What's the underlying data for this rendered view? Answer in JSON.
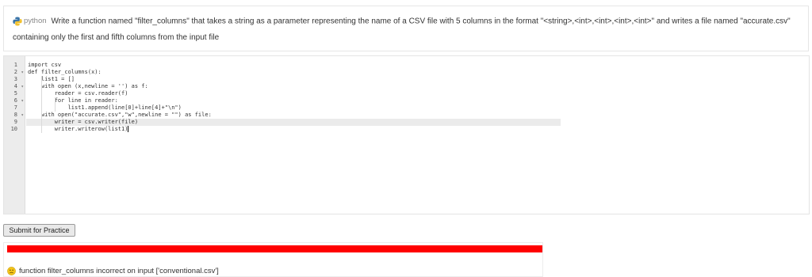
{
  "question": {
    "language": "python",
    "text": "Write a function named \"filter_columns\" that takes a string as a parameter representing the name of a CSV file with 5 columns in the format \"<string>,<int>,<int>,<int>,<int>\" and writes a file named \"accurate.csv\" containing only the first and fifth columns from the input file"
  },
  "editor": {
    "lines": [
      "import csv",
      "def filter_columns(x):",
      "    list1 = []",
      "    with open (x,newline = '') as f:",
      "        reader = csv.reader(f)",
      "        for line in reader:",
      "            list1.append(line[0]+line[4]+\"\\n\")",
      "    with open(\"accurate.csv\",\"w\",newline = \"\") as file:",
      "        writer = csv.writer(file)",
      "        writer.writerow(list1)"
    ],
    "line_numbers": [
      "1",
      "2",
      "3",
      "4",
      "5",
      "6",
      "7",
      "8",
      "9",
      "10"
    ],
    "fold_lines": [
      2,
      4,
      6,
      8
    ],
    "active_line": 10
  },
  "submit_label": "Submit for Practice",
  "result": {
    "status_color": "#ff0000",
    "message": "function filter_columns incorrect on input ['conventional.csv']"
  },
  "icons": {
    "language": "python-logo-icon",
    "result": "sad-face-icon",
    "fold": "fold-arrow-icon"
  }
}
